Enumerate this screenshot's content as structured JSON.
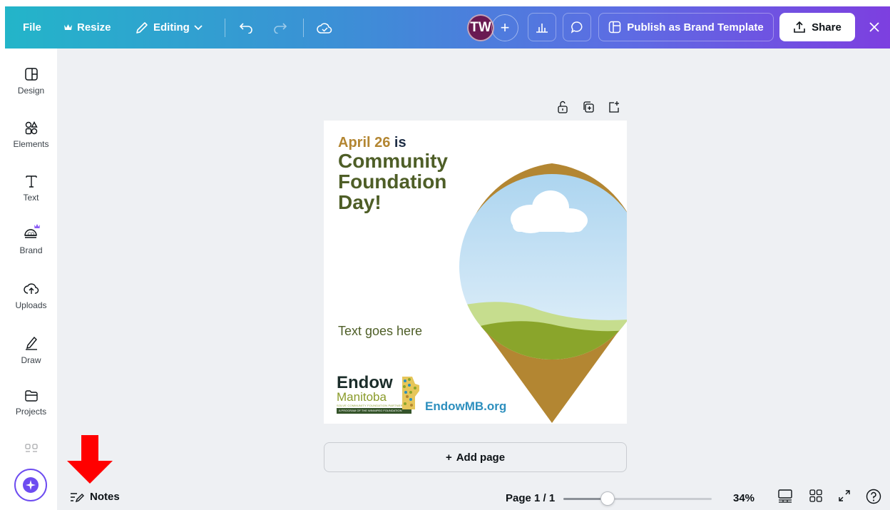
{
  "topbar": {
    "file_label": "File",
    "resize_label": "Resize",
    "editing_label": "Editing",
    "avatar_initials": "TW",
    "publish_label": "Publish as Brand Template",
    "share_label": "Share"
  },
  "sidebar": {
    "items": [
      {
        "label": "Design",
        "icon": "design-icon"
      },
      {
        "label": "Elements",
        "icon": "elements-icon"
      },
      {
        "label": "Text",
        "icon": "text-icon"
      },
      {
        "label": "Brand",
        "icon": "brand-icon"
      },
      {
        "label": "Uploads",
        "icon": "uploads-icon"
      },
      {
        "label": "Draw",
        "icon": "draw-icon"
      },
      {
        "label": "Projects",
        "icon": "projects-icon"
      }
    ]
  },
  "design": {
    "date": "April 26",
    "date_suffix": " is",
    "headline": "Community Foundation Day!",
    "body": "Text goes here",
    "logo_word1": "Endow",
    "logo_word2": "Manitoba",
    "logo_tagline": "SOLVE COMMUNITY FOUNDATION PARTNERS",
    "logo_bar": "A PROGRAM OF THE WINNIPEG FOUNDATION",
    "url": "EndowMB.org"
  },
  "canvas": {
    "add_page_label": "Add page"
  },
  "bottombar": {
    "notes_label": "Notes",
    "page_indicator": "Page 1 / 1",
    "zoom_value": "34%",
    "zoom_fraction": 0.3
  },
  "colors": {
    "accent_purple": "#7d3fe0",
    "accent_teal": "#23b5c9",
    "headline_green": "#4e5e27",
    "date_gold": "#b38632",
    "pin_gold": "#b38632",
    "url_blue": "#2d8fbe",
    "annotation_red": "#ff0000"
  }
}
